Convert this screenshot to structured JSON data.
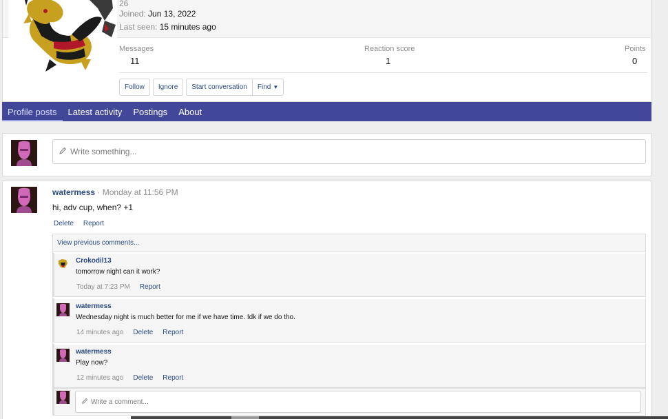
{
  "member": {
    "posts_count_partial": "26",
    "joined_label": "Joined:",
    "joined_value": "Jun 13, 2022",
    "last_seen_label": "Last seen:",
    "last_seen_value": "15 minutes ago",
    "stats": [
      {
        "label": "Messages",
        "value": "11"
      },
      {
        "label": "Reaction score",
        "value": "1"
      },
      {
        "label": "Points",
        "value": "0"
      }
    ],
    "buttons": {
      "follow": "Follow",
      "ignore": "Ignore",
      "start_conversation": "Start conversation",
      "find": "Find"
    }
  },
  "tabs": [
    {
      "label": "Profile posts",
      "active": true
    },
    {
      "label": "Latest activity",
      "active": false
    },
    {
      "label": "Postings",
      "active": false
    },
    {
      "label": "About",
      "active": false
    }
  ],
  "compose": {
    "placeholder": "Write something..."
  },
  "post": {
    "user": "watermess",
    "separator": " · ",
    "time": "Monday at 11:56 PM",
    "body": "hi, adv cup, when? +1",
    "delete": "Delete",
    "report": "Report",
    "view_previous": "View previous comments...",
    "comments": [
      {
        "user": "Crokodil13",
        "text": "tomorrow night can it work?",
        "time": "Today at 7:23 PM",
        "actions": [
          "Report"
        ]
      },
      {
        "user": "watermess",
        "text": "Wednesday night is much better for me if we have time. Idk if we do tho.",
        "time": "14 minutes ago",
        "actions": [
          "Delete",
          "Report"
        ]
      },
      {
        "user": "watermess",
        "text": "Play now?",
        "time": "12 minutes ago",
        "actions": [
          "Delete",
          "Report"
        ]
      }
    ],
    "reply_placeholder": "Write a comment..."
  },
  "colors": {
    "nav_bar": "#43479a",
    "link": "#2a4a84",
    "muted": "#8c8c8c"
  },
  "icons": {
    "compose": "pencil-icon",
    "find_caret": "chevron-down-icon"
  }
}
